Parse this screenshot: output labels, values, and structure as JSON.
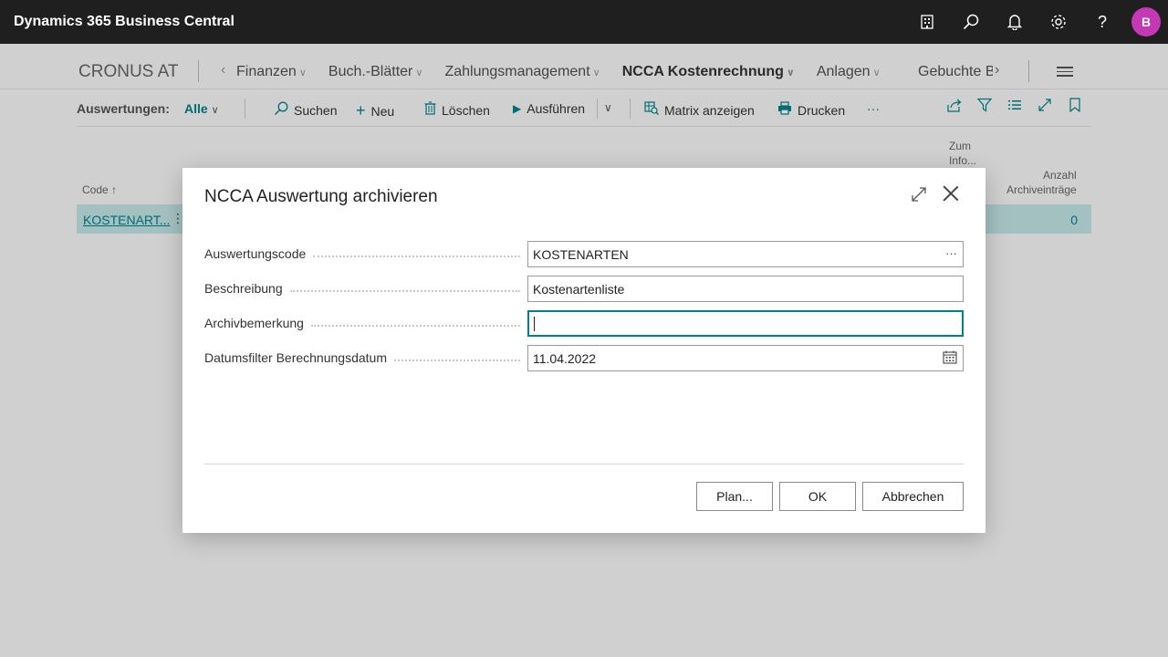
{
  "app": {
    "title": "Dynamics 365 Business Central",
    "avatar_letter": "B"
  },
  "header_icons": [
    "building-icon",
    "search-icon",
    "bell-icon",
    "gear-icon",
    "help-icon"
  ],
  "nav": {
    "company": "CRONUS AT",
    "items": [
      {
        "label": "Finanzen"
      },
      {
        "label": "Buch.-Blätter"
      },
      {
        "label": "Zahlungsmanagement"
      },
      {
        "label": "NCCA Kostenrechnung",
        "active": true
      },
      {
        "label": "Anlagen"
      }
    ],
    "clipped_item": "Gebuchte B"
  },
  "actionbar": {
    "label": "Auswertungen:",
    "filter": "Alle",
    "actions": {
      "search": "Suchen",
      "new": "Neu",
      "delete": "Löschen",
      "run": "Ausführen",
      "matrix": "Matrix anzeigen",
      "print": "Drucken",
      "more": "···"
    }
  },
  "list": {
    "headers": {
      "code": "Code ↑",
      "info_line1": "Zum",
      "info_line2": "Info...",
      "count_line1": "Anzahl",
      "count_line2": "Archiveinträge"
    },
    "rows": [
      {
        "code": "KOSTENART...",
        "count": "0"
      }
    ]
  },
  "dialog": {
    "title": "NCCA Auswertung archivieren",
    "fields": {
      "code": {
        "label": "Auswertungscode",
        "value": "KOSTENARTEN"
      },
      "description": {
        "label": "Beschreibung",
        "value": "Kostenartenliste"
      },
      "remark": {
        "label": "Archivbemerkung",
        "value": ""
      },
      "datefilter": {
        "label": "Datumsfilter Berechnungsdatum",
        "value": "11.04.2022"
      }
    },
    "buttons": {
      "plan": "Plan...",
      "ok": "OK",
      "cancel": "Abbrechen"
    }
  },
  "colors": {
    "accent": "#00818a",
    "appbar": "#1f1f1f",
    "avatar": "#c239b3",
    "selected_row": "#c4e6e8"
  }
}
